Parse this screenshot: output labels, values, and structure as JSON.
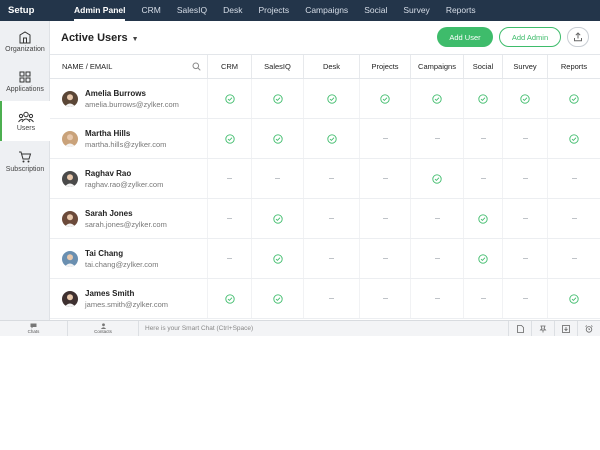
{
  "nav": {
    "setup_label": "Setup",
    "items": [
      "Admin Panel",
      "CRM",
      "SalesIQ",
      "Desk",
      "Projects",
      "Campaigns",
      "Social",
      "Survey",
      "Reports"
    ],
    "active": "Admin Panel"
  },
  "sidebar": {
    "items": [
      {
        "label": "Organization",
        "icon": "organization-icon"
      },
      {
        "label": "Applications",
        "icon": "applications-icon"
      },
      {
        "label": "Users",
        "icon": "users-icon",
        "active": true
      },
      {
        "label": "Subscription",
        "icon": "cart-icon"
      }
    ]
  },
  "header": {
    "title": "Active Users",
    "add_user": "Add User",
    "add_admin": "Add Admin",
    "export_icon": "export-icon"
  },
  "table": {
    "columns": [
      "NAME / EMAIL",
      "CRM",
      "SalesIQ",
      "Desk",
      "Projects",
      "Campaigns",
      "Social",
      "Survey",
      "Reports"
    ],
    "rows": [
      {
        "name": "Amelia Burrows",
        "email": "amelia.burrows@zylker.com",
        "access": [
          true,
          true,
          true,
          true,
          true,
          true,
          true,
          true
        ]
      },
      {
        "name": "Martha Hills",
        "email": "martha.hills@zylker.com",
        "access": [
          true,
          true,
          true,
          false,
          false,
          false,
          false,
          true
        ]
      },
      {
        "name": "Raghav Rao",
        "email": "raghav.rao@zylker.com",
        "access": [
          false,
          false,
          false,
          false,
          true,
          false,
          false,
          false
        ]
      },
      {
        "name": "Sarah Jones",
        "email": "sarah.jones@zylker.com",
        "access": [
          false,
          true,
          false,
          false,
          false,
          true,
          false,
          false
        ]
      },
      {
        "name": "Tai Chang",
        "email": "tai.chang@zylker.com",
        "access": [
          false,
          true,
          false,
          false,
          false,
          true,
          false,
          false
        ]
      },
      {
        "name": "James Smith",
        "email": "james.smith@zylker.com",
        "access": [
          true,
          true,
          false,
          false,
          false,
          false,
          false,
          true
        ]
      }
    ]
  },
  "bottombar": {
    "chats": "Chats",
    "contacts": "Contacts",
    "smart_chat": "Here is your Smart Chat (Ctrl+Space)"
  },
  "colors": {
    "nav_bg": "#23354a",
    "accent_green": "#3ebc6b",
    "check_green": "#3ebc6b"
  }
}
